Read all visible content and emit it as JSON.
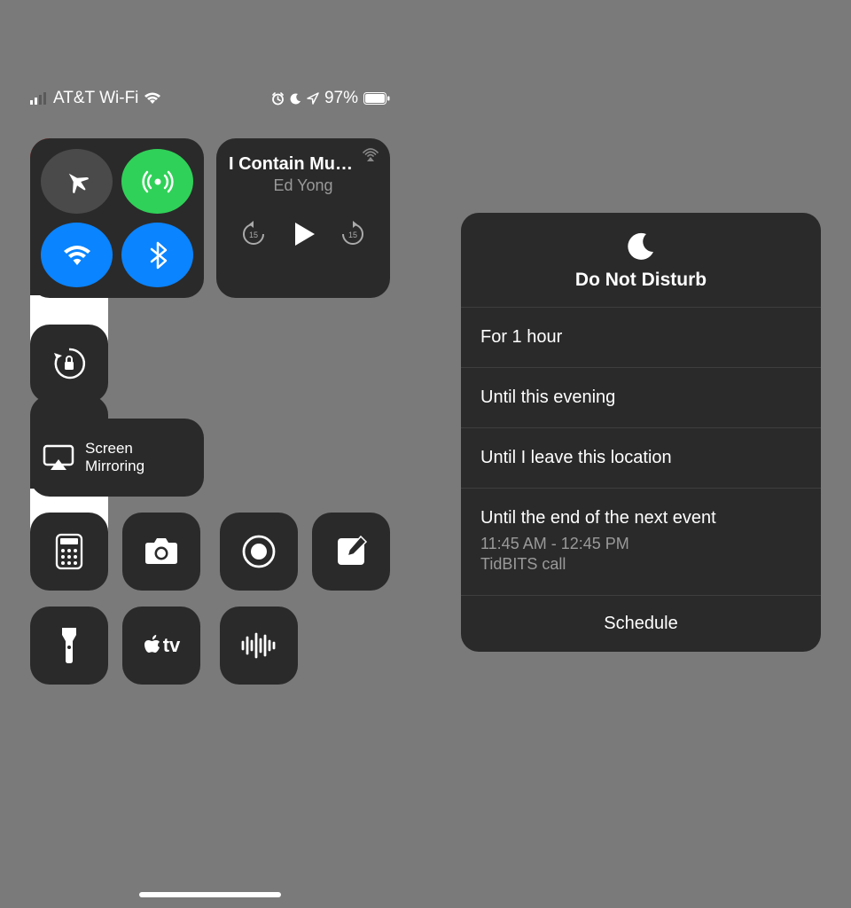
{
  "status": {
    "carrier": "AT&T Wi-Fi",
    "battery_pct": "97%"
  },
  "media": {
    "title": "I Contain Mu…",
    "artist": "Ed Yong"
  },
  "mirroring": {
    "line1": "Screen",
    "line2": "Mirroring"
  },
  "appletv_label": "tv",
  "dnd": {
    "title": "Do Not Disturb",
    "opt1": "For 1 hour",
    "opt2": "Until this evening",
    "opt3": "Until I leave this location",
    "opt4": "Until the end of the next event",
    "opt4_time": "11:45 AM - 12:45 PM",
    "opt4_event": "TidBITS call",
    "schedule": "Schedule"
  }
}
